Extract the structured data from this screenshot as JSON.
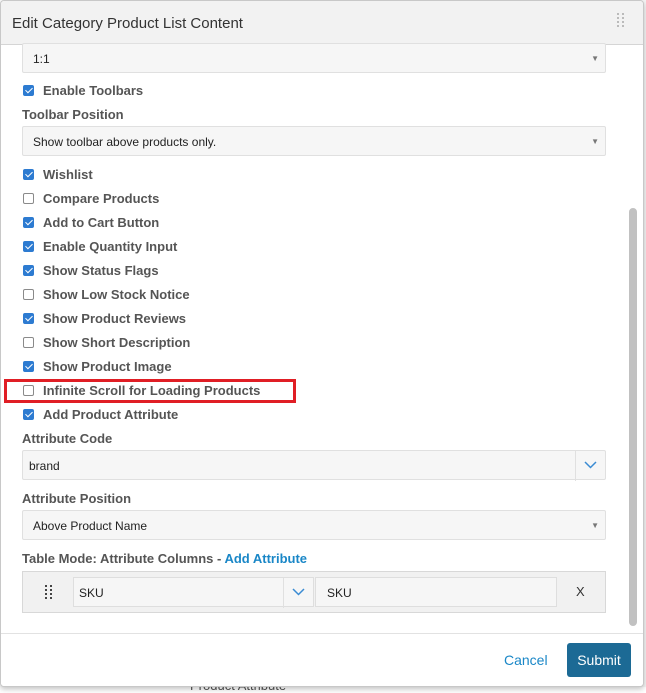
{
  "dialog": {
    "title": "Edit Category Product List Content"
  },
  "form": {
    "aspect_ratio": {
      "value": "1:1"
    },
    "enable_toolbars": {
      "label": "Enable Toolbars",
      "checked": true
    },
    "toolbar_position": {
      "label": "Toolbar Position",
      "value": "Show toolbar above products only."
    },
    "options": [
      {
        "label": "Wishlist",
        "checked": true
      },
      {
        "label": "Compare Products",
        "checked": false
      },
      {
        "label": "Add to Cart Button",
        "checked": true
      },
      {
        "label": "Enable Quantity Input",
        "checked": true
      },
      {
        "label": "Show Status Flags",
        "checked": true
      },
      {
        "label": "Show Low Stock Notice",
        "checked": false
      },
      {
        "label": "Show Product Reviews",
        "checked": true
      },
      {
        "label": "Show Short Description",
        "checked": false
      },
      {
        "label": "Show Product Image",
        "checked": true
      },
      {
        "label": "Infinite Scroll for Loading Products",
        "checked": false
      },
      {
        "label": "Add Product Attribute",
        "checked": true
      }
    ],
    "attribute_code": {
      "label": "Attribute Code",
      "value": "brand"
    },
    "attribute_position": {
      "label": "Attribute Position",
      "value": "Above Product Name"
    },
    "table_mode": {
      "label": "Table Mode: Attribute Columns - ",
      "add_link": "Add Attribute",
      "rows": [
        {
          "attribute": "SKU",
          "column_label": "SKU",
          "remove": "X"
        }
      ]
    }
  },
  "footer": {
    "cancel": "Cancel",
    "submit": "Submit"
  },
  "background": {
    "bottom_text": "Product Attribute"
  },
  "colors": {
    "accent": "#2d7bd1",
    "link": "#1a87c7",
    "submit": "#1c6a95",
    "highlight": "#e01e25"
  }
}
